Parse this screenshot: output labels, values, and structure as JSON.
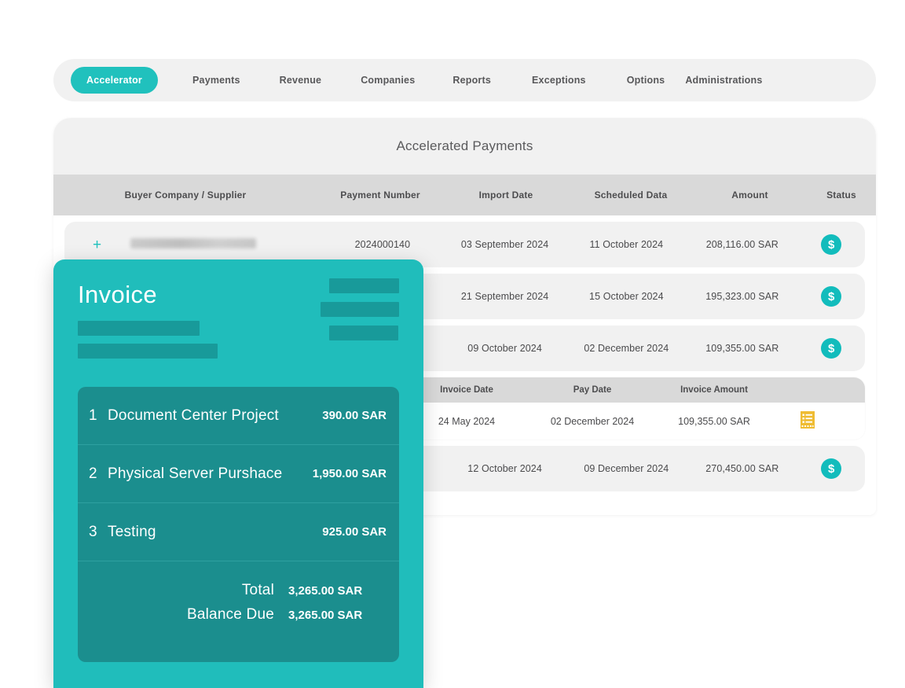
{
  "nav": {
    "active_tab": "Accelerator",
    "items": [
      {
        "label": "Payments"
      },
      {
        "label": "Revenue"
      },
      {
        "label": "Companies"
      },
      {
        "label": "Reports"
      },
      {
        "label": "Exceptions"
      },
      {
        "label": "Options"
      },
      {
        "label": "Administrations"
      }
    ]
  },
  "main": {
    "title": "Accelerated Payments",
    "columns": [
      "Buyer Company / Supplier",
      "Payment Number",
      "Import Date",
      "Scheduled Data",
      "Amount",
      "Status"
    ],
    "expander_glyph": "+",
    "rows": [
      {
        "buyer": "",
        "payment_number": "2024000140",
        "import_date": "03 September 2024",
        "scheduled_date": "11 October 2024",
        "amount": "208,116.00 SAR",
        "status_icon": "dollar-icon",
        "expanded": false,
        "redacted": true,
        "expander": true
      },
      {
        "buyer": "",
        "payment_number": "",
        "import_date": "21 September 2024",
        "scheduled_date": "15 October 2024",
        "amount": "195,323.00 SAR",
        "status_icon": "dollar-icon",
        "expanded": false,
        "redacted": true,
        "expander": false
      },
      {
        "buyer": "",
        "payment_number": "",
        "import_date": "09 October 2024",
        "scheduled_date": "02 December 2024",
        "amount": "109,355.00 SAR",
        "status_icon": "dollar-icon",
        "expanded": true,
        "redacted": true,
        "expander": false
      },
      {
        "buyer": "",
        "payment_number": "",
        "import_date": "12 October 2024",
        "scheduled_date": "09 December 2024",
        "amount": "270,450.00 SAR",
        "status_icon": "dollar-icon",
        "expanded": false,
        "redacted": true,
        "expander": false
      }
    ],
    "sub_table": {
      "columns": [
        "Invoice Date",
        "Pay Date",
        "Invoice Amount"
      ],
      "rows": [
        {
          "invoice_date": "24 May 2024",
          "pay_date": "02 December 2024",
          "invoice_amount": "109,355.00 SAR",
          "action_icon": "invoice-document-icon"
        }
      ]
    }
  },
  "invoice_card": {
    "title": "Invoice",
    "line_items": [
      {
        "num": "1",
        "description": "Document Center Project",
        "amount": "390.00 SAR"
      },
      {
        "num": "2",
        "description": "Physical Server Purshace",
        "amount": "1,950.00 SAR"
      },
      {
        "num": "3",
        "description": "Testing",
        "amount": "925.00  SAR"
      }
    ],
    "totals": [
      {
        "label": "Total",
        "value": "3,265.00 SAR"
      },
      {
        "label": "Balance Due",
        "value": "3,265.00 SAR"
      }
    ]
  },
  "colors": {
    "brand_teal": "#20bdbb",
    "panel_teal": "#1b8e8e",
    "status_teal": "#12bcbc",
    "doc_yellow": "#efbc33",
    "nav_bg": "#f1f1f1",
    "table_head_bg": "#d9d9d9",
    "row_bg": "#f1f1f1"
  }
}
